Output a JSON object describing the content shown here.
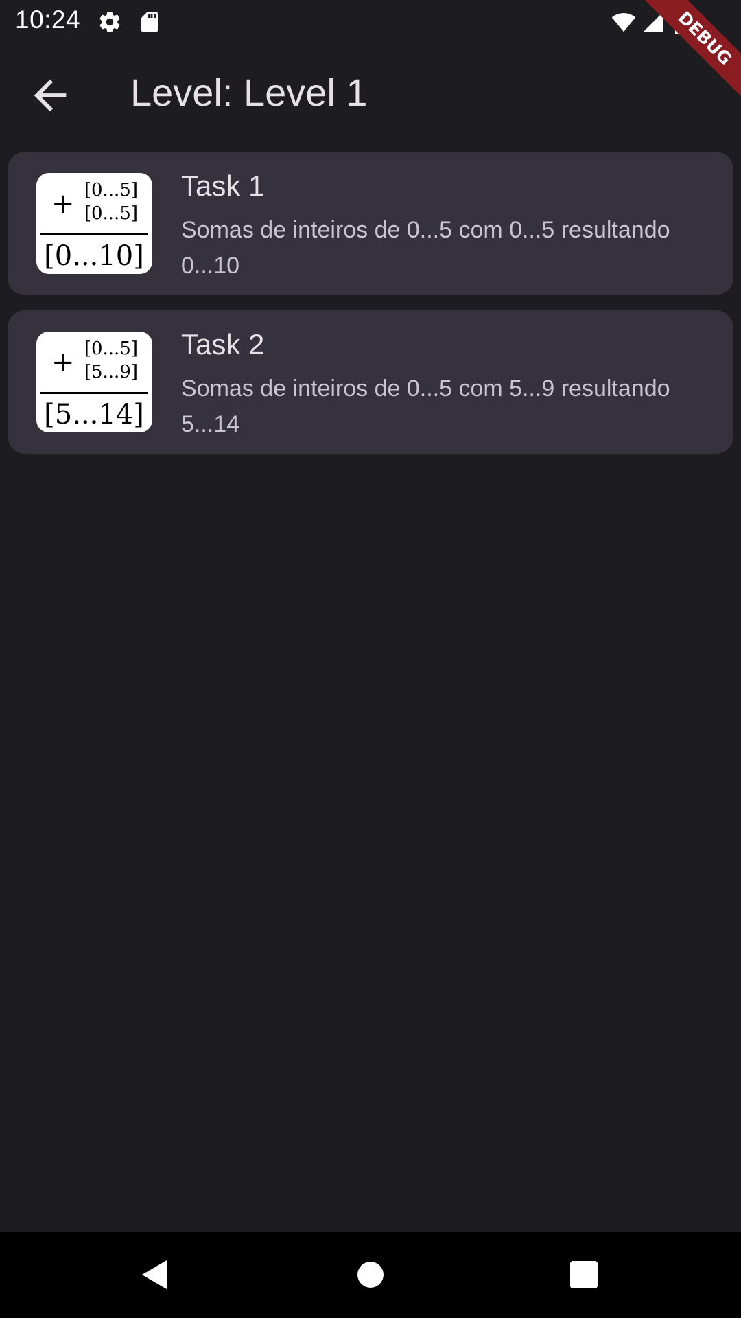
{
  "status_bar": {
    "time": "10:24",
    "icons": [
      "gear-icon",
      "sd-card-icon",
      "wifi-icon",
      "signal-icon",
      "battery-icon"
    ]
  },
  "debug_banner": {
    "label": "DEBUG",
    "color": "#8a1c22"
  },
  "app_bar": {
    "title": "Level: Level 1",
    "back_icon": "arrow-back-icon"
  },
  "tasks": [
    {
      "title": "Task 1",
      "description": "Somas de inteiros de 0...5 com 0...5 resultando 0...10",
      "thumb": {
        "operator": "+",
        "top": "[0...5]",
        "bottom": "[0...5]",
        "result": "[0...10]"
      }
    },
    {
      "title": "Task 2",
      "description": "Somas de inteiros de 0...5 com 5...9 resultando 5...14",
      "thumb": {
        "operator": "+",
        "top": "[0...5]",
        "bottom": "[5...9]",
        "result": "[5...14]"
      }
    }
  ],
  "nav_bar": {
    "icons": [
      "back-triangle-icon",
      "home-circle-icon",
      "recents-square-icon"
    ]
  },
  "colors": {
    "background": "#1d1c21",
    "card": "#35323e",
    "text_primary": "#e6e1e6",
    "text_secondary": "#cbc4cf"
  }
}
